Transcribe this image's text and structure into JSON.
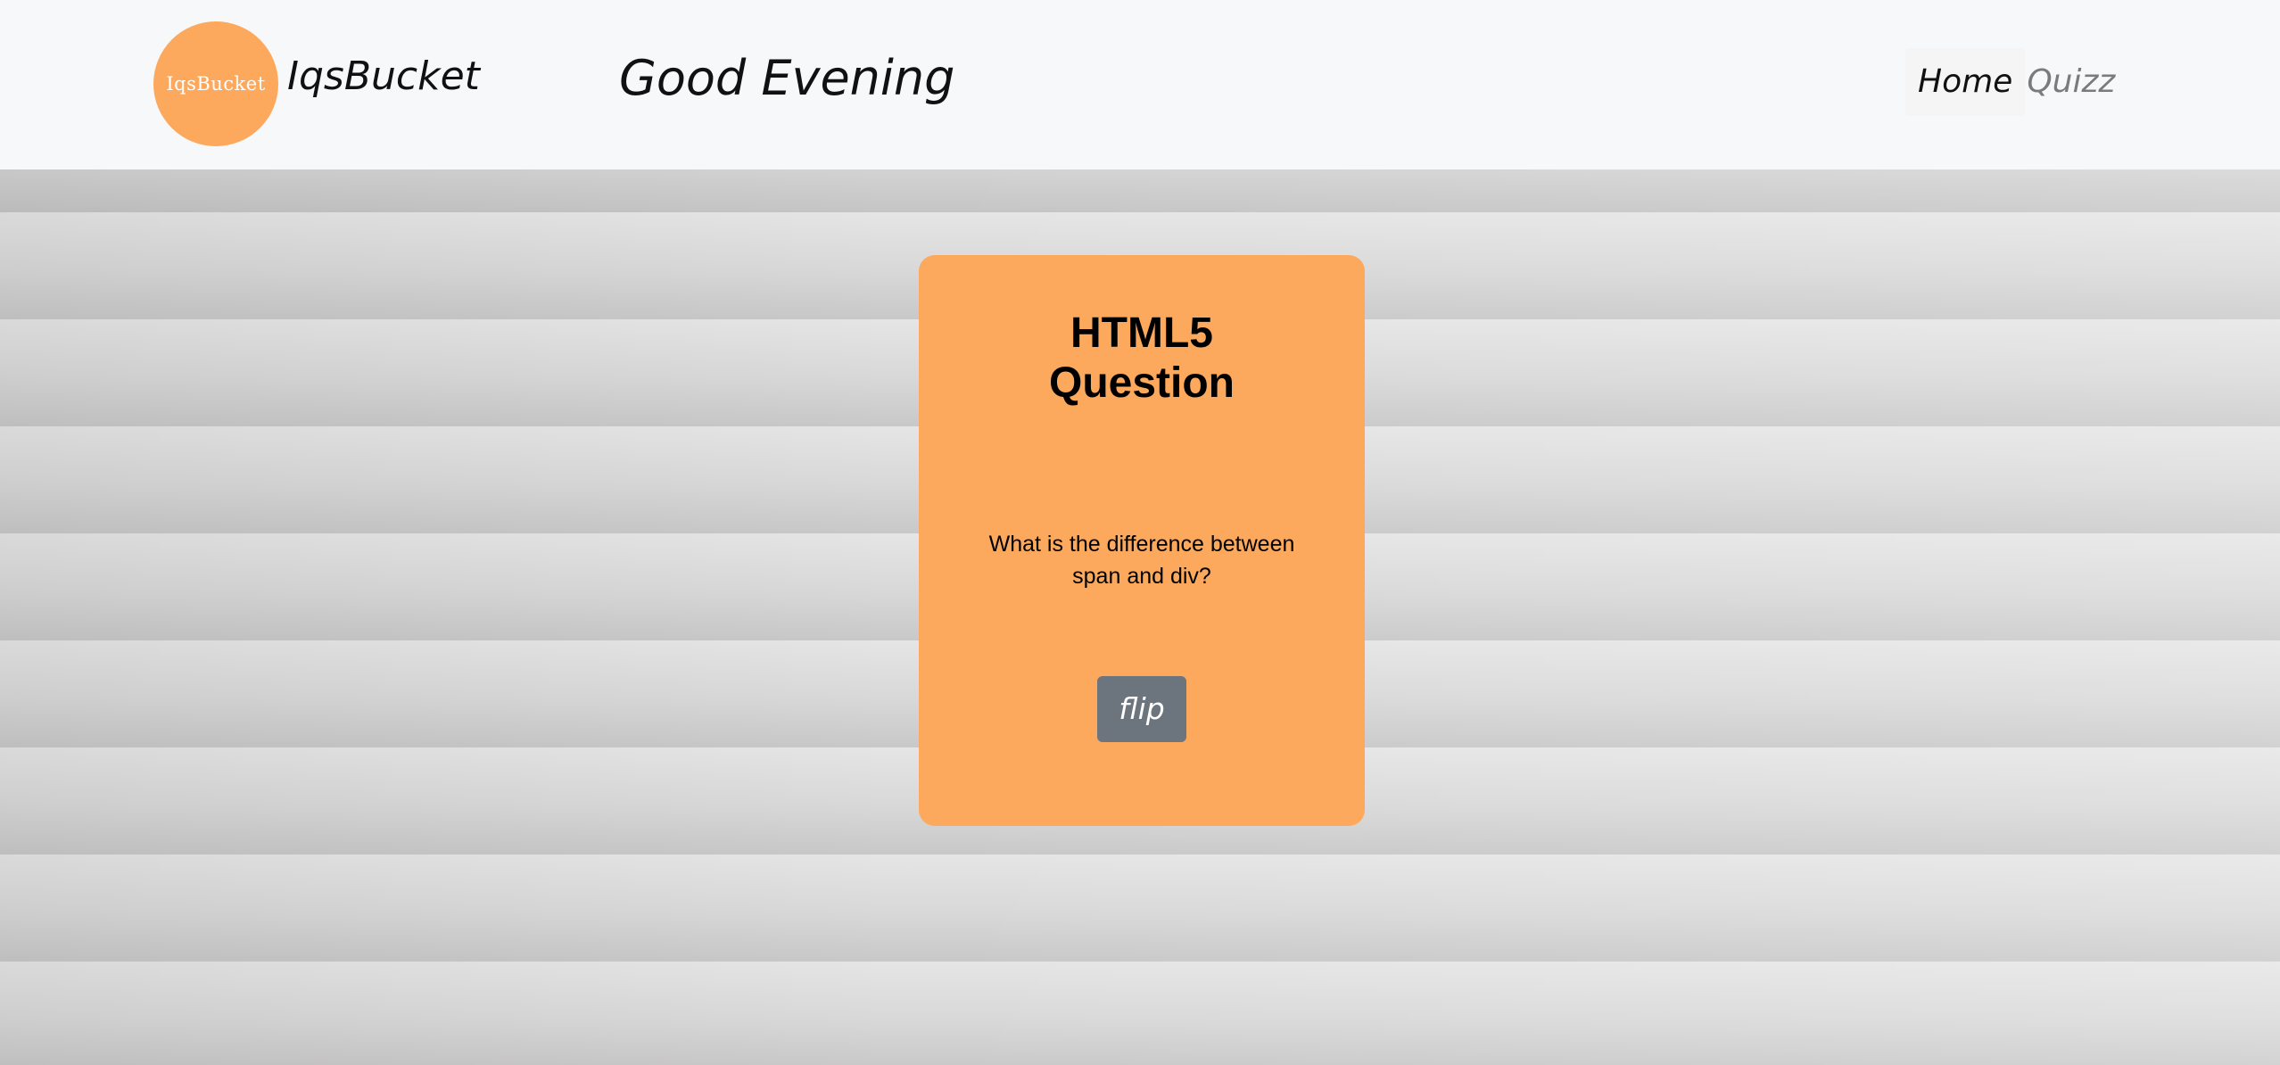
{
  "header": {
    "logo_text": "IqsBucket",
    "brand_name": "IqsBucket",
    "greeting": "Good Evening",
    "nav": [
      {
        "label": "Home",
        "active": true
      },
      {
        "label": "Quizz",
        "active": false
      }
    ]
  },
  "card": {
    "title_line1": "HTML5",
    "title_line2": "Question",
    "question": "What is the difference between span and div?",
    "flip_label": "flip"
  },
  "colors": {
    "accent": "#fca95d",
    "button": "#6c757d",
    "navbar_bg": "#f7f8fa"
  }
}
